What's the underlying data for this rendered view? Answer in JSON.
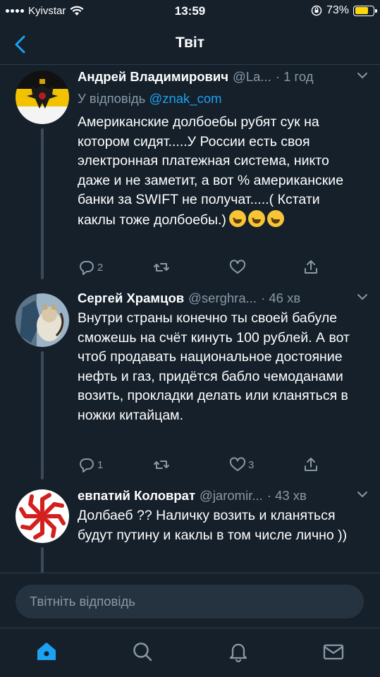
{
  "status": {
    "carrier": "Kyivstar",
    "time": "13:59",
    "battery": "73%",
    "battery_level": 0.73
  },
  "nav": {
    "title": "Твіт"
  },
  "tweets": [
    {
      "name": "Андрей Владимирович",
      "handle": "@La...",
      "time": "· 1 год",
      "reply_prefix": "У відповідь ",
      "reply_to": "@znak_com",
      "text": "Американские долбоебы рубят сук на котором сидят.....У России есть своя электронная платежная система, никто даже и не заметит, а вот % американские банки за SWIFT не получат.....( Кстати каклы тоже долбоебы.)",
      "emojis": [
        "rolling-on-floor-laughing",
        "joy",
        "rolling-on-floor-laughing"
      ],
      "replies": "2",
      "retweets": "",
      "likes": ""
    },
    {
      "name": "Сергей Храмцов",
      "handle": "@serghra...",
      "time": "· 46 хв",
      "text": "Внутри страны конечно ты своей бабуле сможешь на счёт кинуть 100 рублей. А вот чтоб продавать национальное достояние нефть и газ, придётся бабло чемоданами возить, прокладки делать или кланяться в ножки китайцам.",
      "replies": "1",
      "retweets": "",
      "likes": "3"
    },
    {
      "name": "евпатий Коловрат",
      "handle": "@jaromir...",
      "time": "· 43 хв",
      "text": "Долбаеб ?? Наличку возить  и кланяться будут путину и каклы в том числе лично ))"
    }
  ],
  "composer": {
    "placeholder": "Твітніть відповідь"
  },
  "colors": {
    "background": "#15202b",
    "accent": "#1da1f2",
    "muted": "#8899a6"
  },
  "icons": [
    "back-icon",
    "reply-icon",
    "retweet-icon",
    "like-icon",
    "share-icon",
    "home-icon",
    "search-icon",
    "notifications-icon",
    "messages-icon"
  ]
}
